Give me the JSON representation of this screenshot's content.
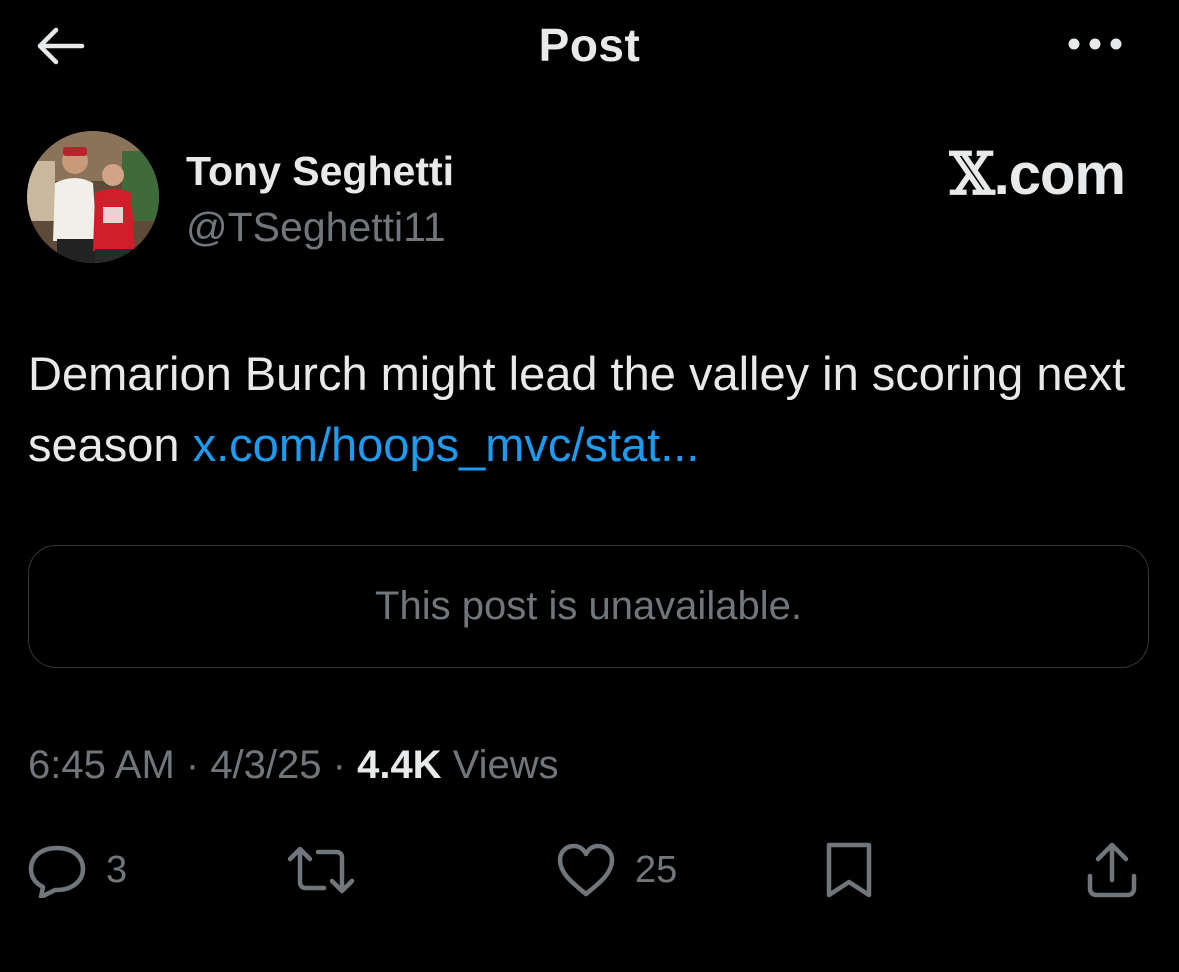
{
  "header": {
    "title": "Post",
    "back_icon": "arrow-left-icon",
    "more_icon": "more-horizontal-icon"
  },
  "author": {
    "name": "Tony Seghetti",
    "handle": "@TSeghetti11",
    "avatar_icon": "avatar-photo"
  },
  "source": {
    "x_glyph": "𝕏",
    "suffix": ".com"
  },
  "post": {
    "text": "Demarion Burch might lead the valley in scoring next season ",
    "link": "x.com/hoops_mvc/stat..."
  },
  "quote": {
    "text": "This post is unavailable."
  },
  "meta": {
    "time": "6:45 AM",
    "sep1": " · ",
    "date": "4/3/25",
    "sep2": " · ",
    "views_count": "4.4K",
    "views_label": " Views"
  },
  "actions": {
    "replies": "3",
    "reposts": "",
    "likes": "25"
  },
  "colors": {
    "background": "#000000",
    "text": "#e7e9ea",
    "muted": "#71767b",
    "link": "#1d9bf0",
    "border": "#333639"
  }
}
